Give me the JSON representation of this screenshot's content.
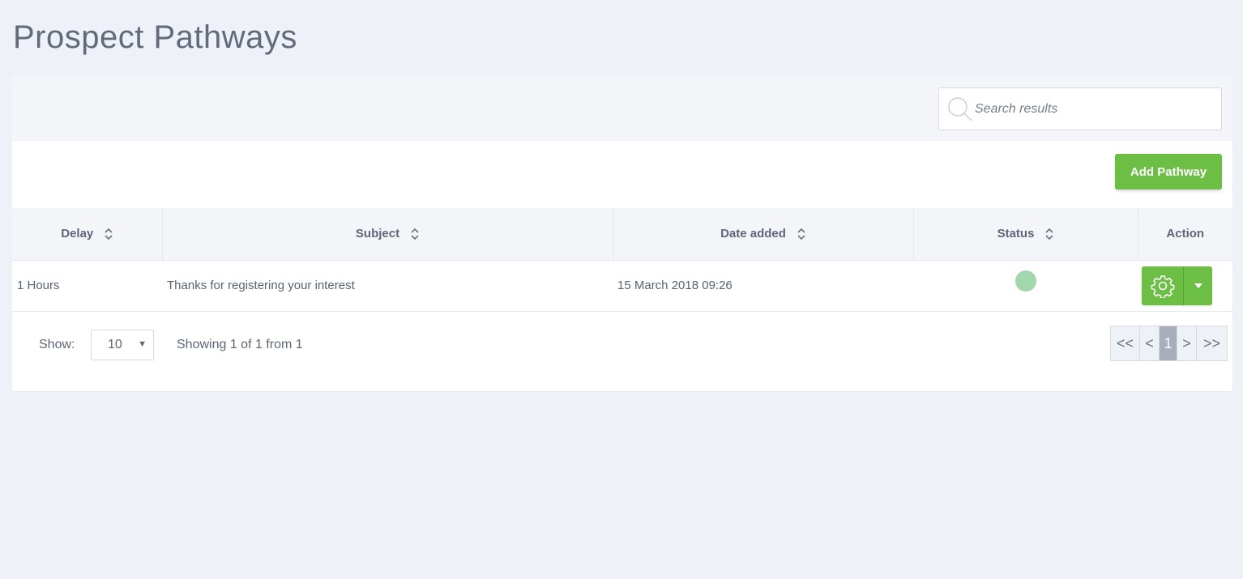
{
  "page": {
    "title": "Prospect Pathways"
  },
  "search": {
    "placeholder": "Search results",
    "value": ""
  },
  "toolbar": {
    "add_label": "Add Pathway"
  },
  "table": {
    "columns": [
      {
        "label": "Delay",
        "sortable": true
      },
      {
        "label": "Subject",
        "sortable": true
      },
      {
        "label": "Date added",
        "sortable": true
      },
      {
        "label": "Status",
        "sortable": true
      },
      {
        "label": "Action",
        "sortable": false
      }
    ],
    "rows": [
      {
        "delay": "1 Hours",
        "subject": "Thanks for registering your interest",
        "date_added": "15 March 2018 09:26",
        "status_color": "#a2d7ad"
      }
    ]
  },
  "footer": {
    "show_label": "Show:",
    "page_size": "10",
    "showing_text": "Showing 1 of 1 from 1"
  },
  "pagination": {
    "first": "<<",
    "prev": "<",
    "current": "1",
    "next": ">",
    "last": ">>"
  },
  "colors": {
    "accent": "#6cbe45",
    "background": "#eef2f8",
    "status_active": "#a2d7ad"
  },
  "icons": {
    "search": "search-icon",
    "sort": "sort-icon",
    "gear": "gear-icon",
    "caret": "caret-down-icon"
  }
}
